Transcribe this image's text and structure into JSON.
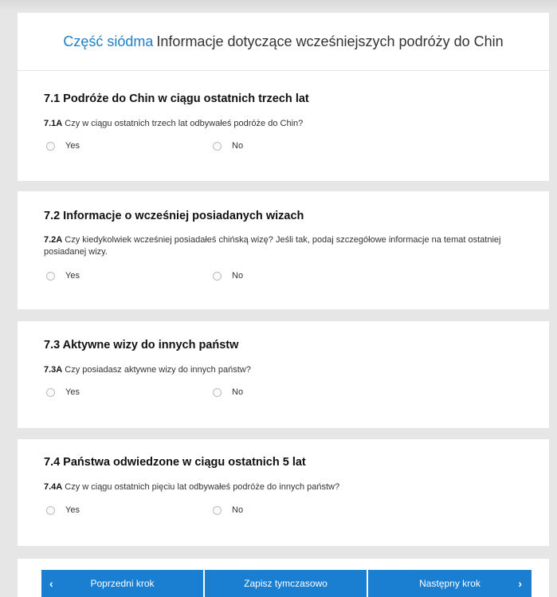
{
  "header": {
    "part_label": "Część siódma",
    "title": "Informacje dotyczące wcześniejszych podróży do Chin"
  },
  "sections": [
    {
      "title": "7.1 Podróże do Chin w ciągu ostatnich trzech lat",
      "question_id": "7.1A",
      "question_text": "Czy w ciągu ostatnich trzech lat odbywałeś podróże do Chin?",
      "options": [
        "Yes",
        "No"
      ]
    },
    {
      "title": "7.2 Informacje o wcześniej posiadanych wizach",
      "question_id": "7.2A",
      "question_text": "Czy kiedykolwiek wcześniej posiadałeś chińską wizę? Jeśli tak, podaj szczegółowe informacje na temat ostatniej posiadanej wizy.",
      "options": [
        "Yes",
        "No"
      ]
    },
    {
      "title": "7.3 Aktywne wizy do innych państw",
      "question_id": "7.3A",
      "question_text": "Czy posiadasz aktywne wizy do innych państw?",
      "options": [
        "Yes",
        "No"
      ]
    },
    {
      "title": "7.4 Państwa odwiedzone w ciągu ostatnich 5 lat",
      "question_id": "7.4A",
      "question_text": "Czy w ciągu ostatnich pięciu lat odbywałeś podróże do innych państw?",
      "options": [
        "Yes",
        "No"
      ]
    }
  ],
  "footer": {
    "prev_label": "Poprzedni krok",
    "save_label": "Zapisz tymczasowo",
    "next_label": "Następny krok",
    "prev_icon": "chevron-left-icon",
    "next_icon": "chevron-right-icon"
  },
  "colors": {
    "accent": "#1f7ec4",
    "button": "#1a7ed1",
    "background": "#e6e6e6"
  }
}
